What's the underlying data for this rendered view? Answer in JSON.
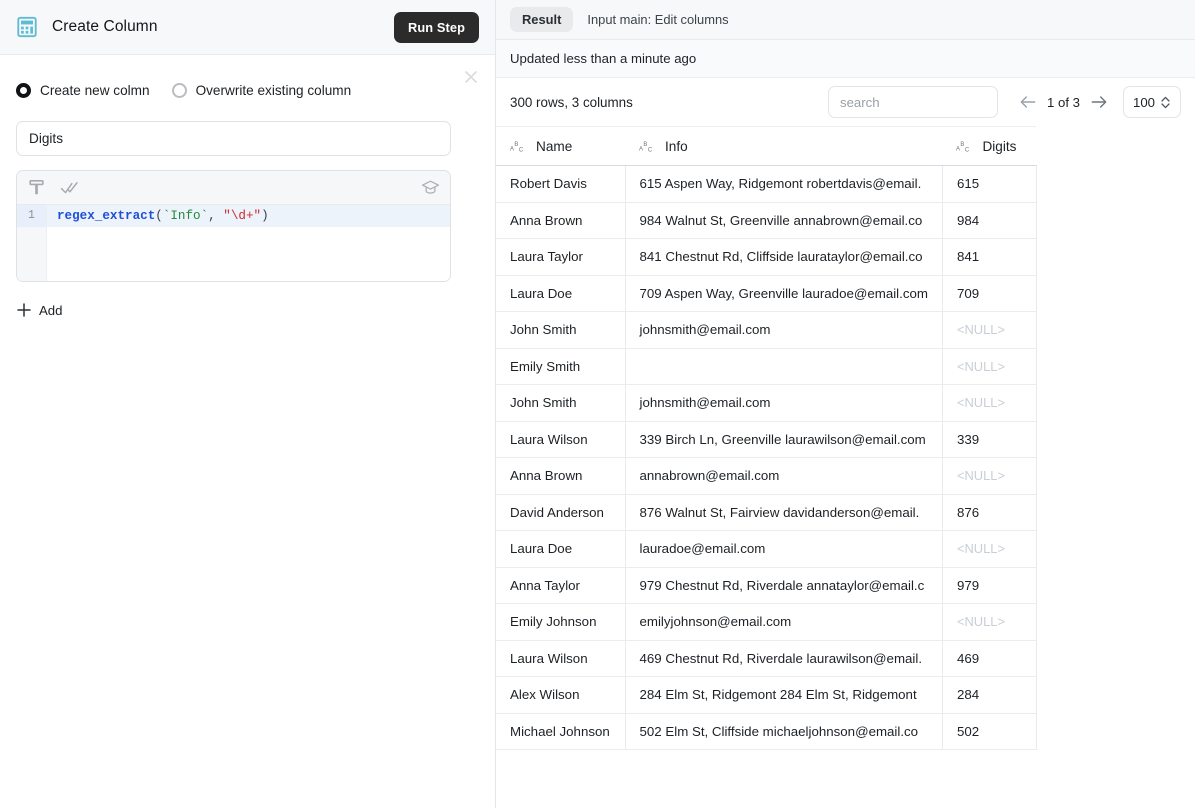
{
  "left": {
    "header": {
      "icon": "calculator-icon",
      "icon_color": "#5bbcd4",
      "title": "Create Column",
      "run_button": "Run Step"
    },
    "mode_options": [
      {
        "label": "Create new colmn",
        "selected": true
      },
      {
        "label": "Overwrite existing column",
        "selected": false
      }
    ],
    "column_name_input": {
      "value": "Digits",
      "placeholder": ""
    },
    "editor": {
      "toolbar_icons": [
        "format-icon",
        "double-check-icon",
        "graduation-cap-icon"
      ],
      "line_number": "1",
      "code": {
        "fn": "regex_extract",
        "open_paren": "(",
        "column_ref": "`Info`",
        "comma": ", ",
        "pattern": "\"\\d+\"",
        "close_paren": ")",
        "full": "regex_extract(`Info`, \"\\d+\")"
      }
    },
    "add_label": "Add",
    "close_icon": "close-icon"
  },
  "right": {
    "tabs": [
      {
        "label": "Result",
        "active": true
      },
      {
        "label": "Input main: Edit columns",
        "active": false
      }
    ],
    "updated_text": "Updated less than a minute ago",
    "row_count_text": "300 rows, 3 columns",
    "search": {
      "value": "",
      "placeholder": "search"
    },
    "pagination": {
      "label": "1 of 3",
      "prev_icon": "arrow-left-icon",
      "next_icon": "arrow-right-icon"
    },
    "page_size": {
      "value": "100",
      "chevron": "chevron-updown-icon"
    },
    "table": {
      "columns": [
        {
          "label": "Name",
          "type_icon": "abc-text-type-icon"
        },
        {
          "label": "Info",
          "type_icon": "abc-text-type-icon"
        },
        {
          "label": "Digits",
          "type_icon": "abc-text-type-icon"
        }
      ],
      "null_display": "<NULL>",
      "rows": [
        {
          "name": "Robert Davis",
          "info": "615 Aspen Way, Ridgemont robertdavis@email.",
          "digits": "615"
        },
        {
          "name": "Anna Brown",
          "info": "984 Walnut St, Greenville annabrown@email.co",
          "digits": "984"
        },
        {
          "name": "Laura Taylor",
          "info": "841 Chestnut Rd, Cliffside laurataylor@email.co",
          "digits": "841"
        },
        {
          "name": "Laura Doe",
          "info": "709 Aspen Way, Greenville lauradoe@email.com",
          "digits": "709"
        },
        {
          "name": "John Smith",
          "info": "johnsmith@email.com",
          "digits": "<NULL>"
        },
        {
          "name": "Emily Smith",
          "info": "",
          "digits": "<NULL>"
        },
        {
          "name": "John Smith",
          "info": "johnsmith@email.com",
          "digits": "<NULL>"
        },
        {
          "name": "Laura Wilson",
          "info": "339 Birch Ln, Greenville laurawilson@email.com",
          "digits": "339"
        },
        {
          "name": "Anna Brown",
          "info": "annabrown@email.com",
          "digits": "<NULL>"
        },
        {
          "name": "David Anderson",
          "info": "876 Walnut St, Fairview davidanderson@email.",
          "digits": "876"
        },
        {
          "name": "Laura Doe",
          "info": "lauradoe@email.com",
          "digits": "<NULL>"
        },
        {
          "name": "Anna Taylor",
          "info": "979 Chestnut Rd, Riverdale annataylor@email.c",
          "digits": "979"
        },
        {
          "name": "Emily Johnson",
          "info": "emilyjohnson@email.com",
          "digits": "<NULL>"
        },
        {
          "name": "Laura Wilson",
          "info": "469 Chestnut Rd, Riverdale laurawilson@email.",
          "digits": "469"
        },
        {
          "name": "Alex Wilson",
          "info": "284 Elm St, Ridgemont 284 Elm St, Ridgemont",
          "digits": "284"
        },
        {
          "name": "Michael Johnson",
          "info": "502 Elm St, Cliffside michaeljohnson@email.co",
          "digits": "502"
        }
      ]
    }
  }
}
